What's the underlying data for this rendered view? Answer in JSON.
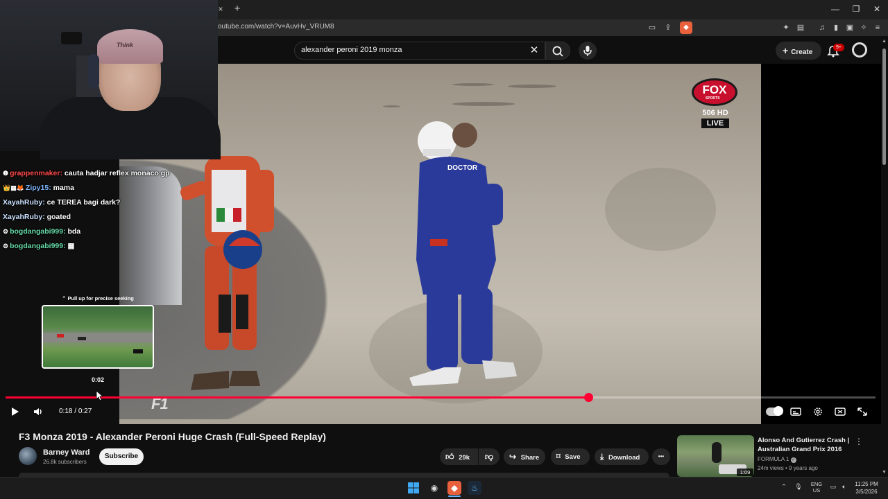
{
  "browser": {
    "tab_close": "×",
    "new_tab": "+",
    "url": "outube.com/watch?v=AuvHv_VRUM8",
    "window_controls": {
      "minimize": "—",
      "restore": "❐",
      "close": "✕"
    }
  },
  "youtube": {
    "search_query": "alexander peroni 2019 monza",
    "create_label": "Create",
    "notification_badge": "9+"
  },
  "stream_overlay": {
    "chat": [
      {
        "badges": "❶",
        "user": "grappenmaker",
        "user_color": "#ff4a4a",
        "message": "cauta hadjar reflex monaco gp"
      },
      {
        "badges": "👑▦🦊",
        "user": "Zipy15",
        "user_color": "#7fb8ff",
        "message": "mama"
      },
      {
        "badges": "",
        "user": "XayahRuby",
        "user_color": "#c9e0ff",
        "message": "ce TEREA bagi dark?"
      },
      {
        "badges": "",
        "user": "XayahRuby",
        "user_color": "#c9e0ff",
        "message": "goated"
      },
      {
        "badges": "⚙",
        "user": "bogdangabi999",
        "user_color": "#67d9a8",
        "message": "bda"
      },
      {
        "badges": "⚙",
        "user": "bogdangabi999",
        "user_color": "#67d9a8",
        "message": "▦"
      }
    ],
    "cap_text": "Think"
  },
  "video": {
    "broadcaster_logo": "FOX",
    "broadcaster_sub": "SPORTS",
    "channel_number": "506 HD",
    "live_label": "LIVE",
    "series_logo": "F1"
  },
  "player": {
    "seek_hint": "⌃ Pull up for precise seeking",
    "seek_preview_time": "0:02",
    "current_time": "0:18",
    "duration": "0:27",
    "time_separator": "/",
    "progress_fraction": 0.67,
    "accent_color": "#ff0033"
  },
  "video_info": {
    "title": "F3 Monza 2019 - Alexander Peroni Huge Crash (Full-Speed Replay)",
    "channel_name": "Barney Ward",
    "subscribers": "26.8k subscribers",
    "subscribe_label": "Subscribe",
    "likes": "29k",
    "share_label": "Share",
    "save_label": "Save",
    "download_label": "Download",
    "more_label": "•••"
  },
  "recommendation": {
    "title": "Alonso And Gutierrez Crash | Australian Grand Prix 2016",
    "channel": "FORMULA 1",
    "meta": "24m views • 9 years ago",
    "duration": "1:09"
  },
  "taskbar": {
    "language": "ENG",
    "region": "US",
    "time": "11:25 PM",
    "date": "3/5/2026"
  }
}
